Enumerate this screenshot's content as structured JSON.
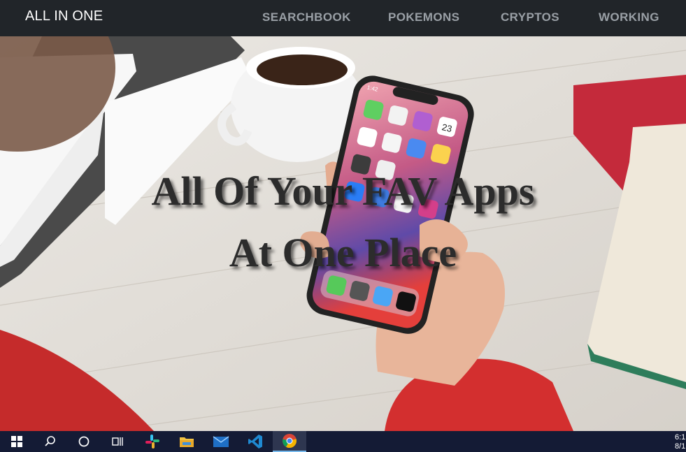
{
  "navbar": {
    "brand": "ALL IN ONE",
    "links": [
      {
        "label": "SEARCHBOOK"
      },
      {
        "label": "POKEMONS"
      },
      {
        "label": "CRYPTOS"
      },
      {
        "label": "WORKING"
      }
    ]
  },
  "hero": {
    "line1": "All Of Your FAV Apps",
    "line2": "At One Place",
    "phone_status_time": "1:42",
    "calendar_day": "23"
  },
  "taskbar": {
    "items": [
      {
        "icon": "windows-start-icon"
      },
      {
        "icon": "search-icon"
      },
      {
        "icon": "cortana-icon"
      },
      {
        "icon": "task-view-icon"
      },
      {
        "icon": "slack-icon"
      },
      {
        "icon": "file-explorer-icon"
      },
      {
        "icon": "mail-icon"
      },
      {
        "icon": "vscode-icon"
      },
      {
        "icon": "chrome-icon"
      }
    ],
    "clock_time": "6:1",
    "clock_date": "8/1"
  },
  "colors": {
    "navbar_bg": "#212529",
    "nav_link": "#9aa0a6",
    "taskbar_bg": "#141b35",
    "taskbar_accent": "#76b9ed"
  }
}
